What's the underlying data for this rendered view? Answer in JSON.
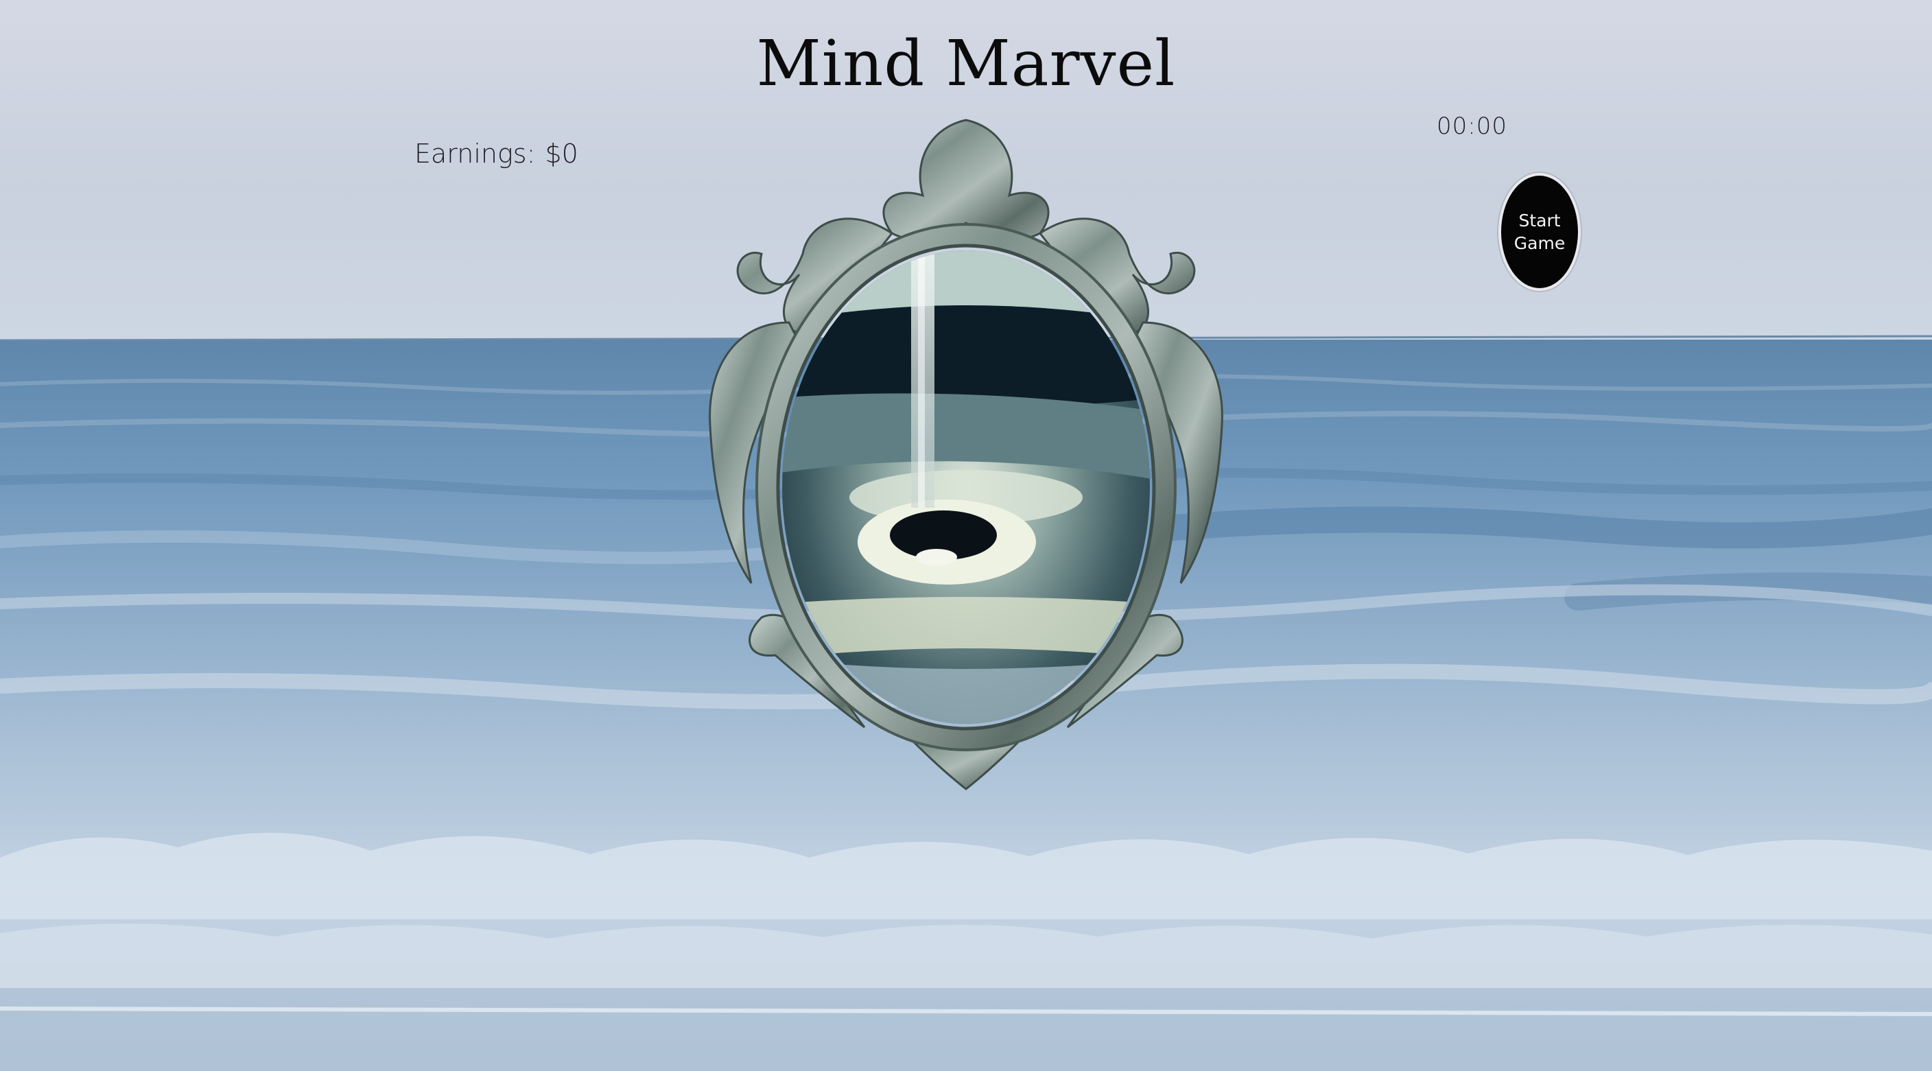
{
  "game": {
    "title": "Mind Marvel",
    "earnings_label": "Earnings:",
    "earnings_value": "$0",
    "timer": "00:00",
    "start_button": {
      "line1": "Start",
      "line2": "Game"
    }
  },
  "palette": {
    "sky": "#d2d8e3",
    "ocean": "#6f93b4",
    "foam": "#d7e2ee",
    "frame_silver": "#8a9c96",
    "button_black": "#050505"
  }
}
